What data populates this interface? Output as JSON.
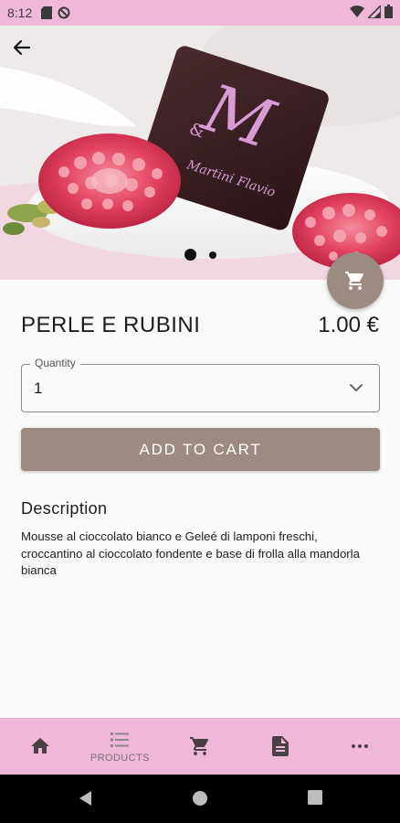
{
  "status_bar": {
    "time": "8:12"
  },
  "hero": {
    "logo_initials": "M",
    "logo_sub": "&",
    "logo_text": "Martini Flavio",
    "carousel_total": 2,
    "carousel_active": 1
  },
  "product": {
    "title": "PERLE E RUBINI",
    "price": "1.00 €"
  },
  "quantity": {
    "label": "Quantity",
    "value": "1"
  },
  "add_to_cart_label": "ADD TO CART",
  "description": {
    "heading": "Description",
    "text": "Mousse al cioccolato bianco e Geleé di lamponi freschi, croccantino al cioccolato fondente e base di frolla alla mandorla bianca"
  },
  "bottom_nav": {
    "items": [
      {
        "icon": "home-icon",
        "label": ""
      },
      {
        "icon": "list-icon",
        "label": "PRODUCTS"
      },
      {
        "icon": "cart-icon",
        "label": ""
      },
      {
        "icon": "document-icon",
        "label": ""
      },
      {
        "icon": "more-icon",
        "label": ""
      }
    ]
  },
  "colors": {
    "accent_pink": "#f0b8d8",
    "button_taupe": "#9c8b82",
    "chocolate": "#3a1f22",
    "raspberry": "#e2405f"
  }
}
